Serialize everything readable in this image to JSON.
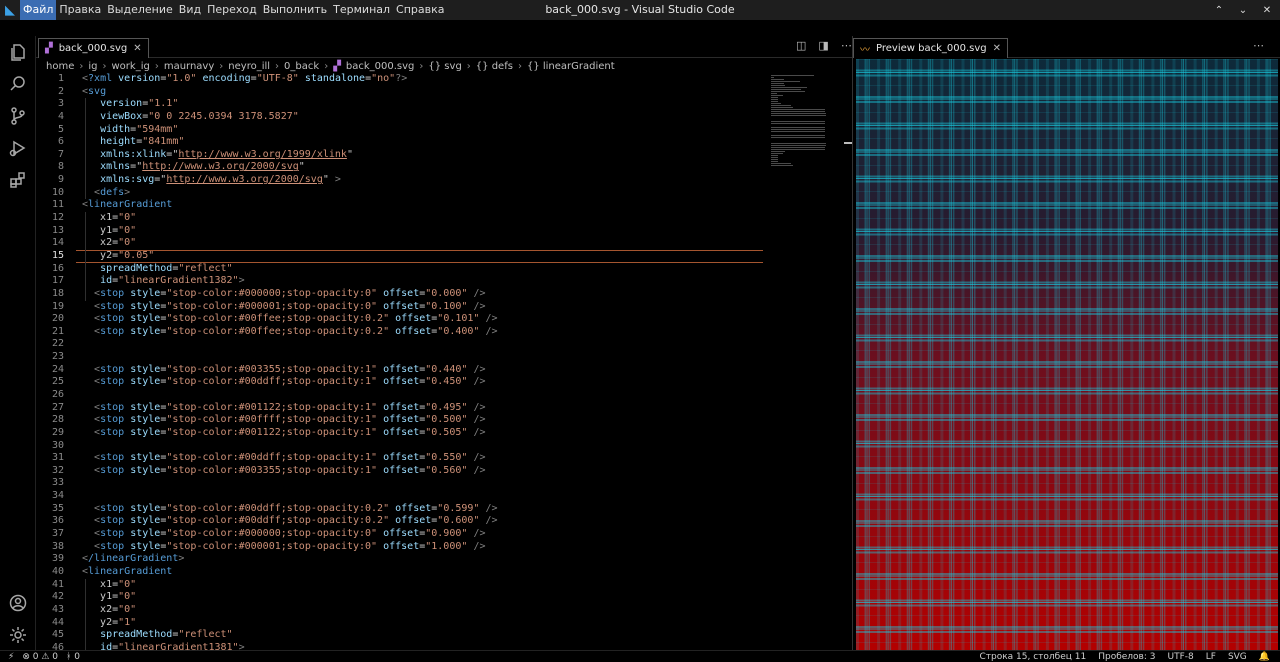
{
  "window": {
    "title": "back_000.svg - Visual Studio Code",
    "controls": [
      "⌃",
      "⌄",
      "✕"
    ]
  },
  "menu": [
    "Файл",
    "Правка",
    "Выделение",
    "Вид",
    "Переход",
    "Выполнить",
    "Терминал",
    "Справка"
  ],
  "activity_bar": [
    "files-icon",
    "search-icon",
    "source-control-icon",
    "run-debug-icon",
    "extensions-icon",
    "account-icon",
    "settings-gear-icon"
  ],
  "editor_tab": {
    "label": "back_000.svg",
    "close": "✕"
  },
  "preview_tab": {
    "label": "Preview back_000.svg",
    "close": "✕"
  },
  "breadcrumb": [
    "home",
    "ig",
    "work_ig",
    "maurnavy",
    "neyro_ill",
    "0_back",
    "back_000.svg",
    "{} svg",
    "{} defs",
    "{} linearGradient"
  ],
  "editor": {
    "current_line": 15,
    "lines": [
      {
        "n": "1",
        "t": "<?xml version=\"1.0\" encoding=\"UTF-8\" standalone=\"no\"?>"
      },
      {
        "n": "2",
        "t": "<svg"
      },
      {
        "n": "3",
        "t": "   version=\"1.1\""
      },
      {
        "n": "4",
        "t": "   viewBox=\"0 0 2245.0394 3178.5827\""
      },
      {
        "n": "5",
        "t": "   width=\"594mm\""
      },
      {
        "n": "6",
        "t": "   height=\"841mm\""
      },
      {
        "n": "7",
        "t": "   xmlns:xlink=\"http://www.w3.org/1999/xlink\""
      },
      {
        "n": "8",
        "t": "   xmlns=\"http://www.w3.org/2000/svg\""
      },
      {
        "n": "9",
        "t": "   xmlns:svg=\"http://www.w3.org/2000/svg\" >"
      },
      {
        "n": "10",
        "t": "  <defs>"
      },
      {
        "n": "11",
        "t": "<linearGradient"
      },
      {
        "n": "12",
        "t": "   x1=\"0\""
      },
      {
        "n": "13",
        "t": "   y1=\"0\""
      },
      {
        "n": "14",
        "t": "   x2=\"0\""
      },
      {
        "n": "15",
        "t": "   y2=\"0.05\""
      },
      {
        "n": "16",
        "t": "   spreadMethod=\"reflect\""
      },
      {
        "n": "17",
        "t": "   id=\"linearGradient1382\">"
      },
      {
        "n": "18",
        "t": "  <stop style=\"stop-color:#000000;stop-opacity:0\" offset=\"0.000\" />"
      },
      {
        "n": "19",
        "t": "  <stop style=\"stop-color:#000001;stop-opacity:0\" offset=\"0.100\" />"
      },
      {
        "n": "20",
        "t": "  <stop style=\"stop-color:#00ffee;stop-opacity:0.2\" offset=\"0.101\" />"
      },
      {
        "n": "21",
        "t": "  <stop style=\"stop-color:#00ffee;stop-opacity:0.2\" offset=\"0.400\" />"
      },
      {
        "n": "22",
        "t": ""
      },
      {
        "n": "23",
        "t": ""
      },
      {
        "n": "24",
        "t": "  <stop style=\"stop-color:#003355;stop-opacity:1\" offset=\"0.440\" />"
      },
      {
        "n": "25",
        "t": "  <stop style=\"stop-color:#00ddff;stop-opacity:1\" offset=\"0.450\" />"
      },
      {
        "n": "26",
        "t": ""
      },
      {
        "n": "27",
        "t": "  <stop style=\"stop-color:#001122;stop-opacity:1\" offset=\"0.495\" />"
      },
      {
        "n": "28",
        "t": "  <stop style=\"stop-color:#00ffff;stop-opacity:1\" offset=\"0.500\" />"
      },
      {
        "n": "29",
        "t": "  <stop style=\"stop-color:#001122;stop-opacity:1\" offset=\"0.505\" />"
      },
      {
        "n": "30",
        "t": ""
      },
      {
        "n": "31",
        "t": "  <stop style=\"stop-color:#00ddff;stop-opacity:1\" offset=\"0.550\" />"
      },
      {
        "n": "32",
        "t": "  <stop style=\"stop-color:#003355;stop-opacity:1\" offset=\"0.560\" />"
      },
      {
        "n": "33",
        "t": ""
      },
      {
        "n": "34",
        "t": ""
      },
      {
        "n": "35",
        "t": "  <stop style=\"stop-color:#00ddff;stop-opacity:0.2\" offset=\"0.599\" />"
      },
      {
        "n": "36",
        "t": "  <stop style=\"stop-color:#00ddff;stop-opacity:0.2\" offset=\"0.600\" />"
      },
      {
        "n": "37",
        "t": "  <stop style=\"stop-color:#000000;stop-opacity:0\" offset=\"0.900\" />"
      },
      {
        "n": "38",
        "t": "  <stop style=\"stop-color:#000001;stop-opacity:0\" offset=\"1.000\" />"
      },
      {
        "n": "39",
        "t": "</linearGradient>"
      },
      {
        "n": "40",
        "t": "<linearGradient"
      },
      {
        "n": "41",
        "t": "   x1=\"0\""
      },
      {
        "n": "42",
        "t": "   y1=\"0\""
      },
      {
        "n": "43",
        "t": "   x2=\"0\""
      },
      {
        "n": "44",
        "t": "   y2=\"1\""
      },
      {
        "n": "45",
        "t": "   spreadMethod=\"reflect\""
      },
      {
        "n": "46",
        "t": "   id=\"linearGradient1381\">"
      }
    ]
  },
  "preview": {
    "top_color": "#0d2a3a",
    "bottom_color": "#b30000",
    "line_color": "#18c8dc"
  },
  "status_bar": {
    "left": [
      "⚡",
      "⊗ 0 ⚠ 0",
      "ᚼ 0"
    ],
    "right": [
      "Строка 15, столбец 11",
      "Пробелов: 3",
      "UTF-8",
      "LF",
      "SVG",
      "🔔"
    ]
  },
  "colors": {
    "accent": "#3b6db3",
    "current_line_border": "#a5552f",
    "tag": "#569cd6",
    "attr": "#9cdcfe",
    "string": "#ce9178"
  }
}
